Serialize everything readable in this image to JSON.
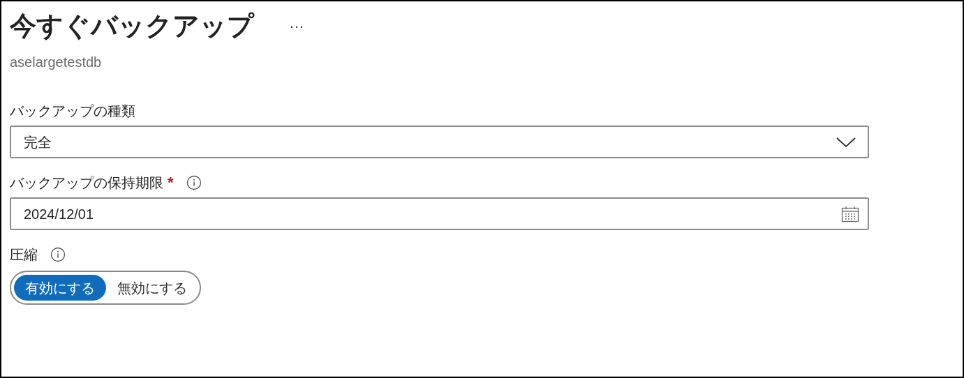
{
  "title": "今すぐバックアップ",
  "more": "…",
  "subtitle": "aselargetestdb",
  "required_mark": "*",
  "fields": [
    {
      "kind": "dropdown",
      "label": "バックアップの種類",
      "required": false,
      "info": false,
      "value": "完全"
    },
    {
      "kind": "date",
      "label": "バックアップの保持期限",
      "required": true,
      "info": true,
      "value": "2024/12/01"
    },
    {
      "kind": "toggle",
      "label": "圧縮",
      "required": false,
      "info": true,
      "options": [
        {
          "label": "有効にする",
          "selected": true
        },
        {
          "label": "無効にする",
          "selected": false
        }
      ]
    }
  ]
}
